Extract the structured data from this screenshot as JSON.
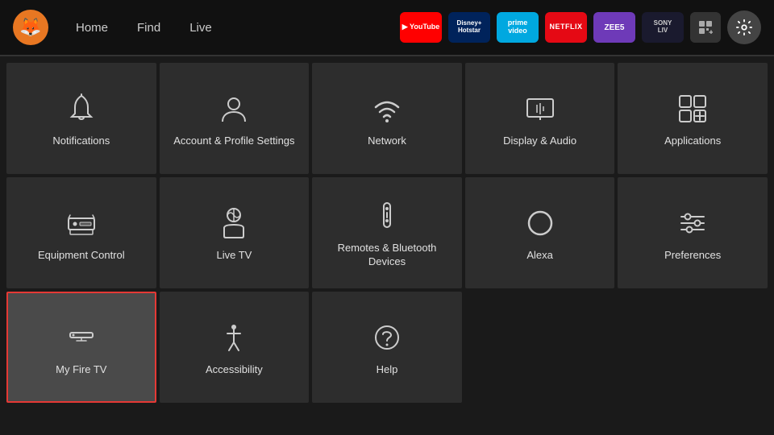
{
  "nav": {
    "logo_emoji": "🦊",
    "links": [
      "Home",
      "Find",
      "Live"
    ],
    "apps": [
      {
        "id": "youtube",
        "label": "▶ YouTube",
        "class": "app-youtube"
      },
      {
        "id": "disney",
        "label": "Disney+ Hotstar",
        "class": "app-disney"
      },
      {
        "id": "prime",
        "label": "prime video",
        "class": "app-prime"
      },
      {
        "id": "netflix",
        "label": "NETFLIX",
        "class": "app-netflix"
      },
      {
        "id": "zee5",
        "label": "ZEE5",
        "class": "app-zee5"
      },
      {
        "id": "sonyliv",
        "label": "SONY LIV",
        "class": "app-sonyliv"
      }
    ]
  },
  "grid": {
    "items": [
      {
        "id": "notifications",
        "label": "Notifications",
        "selected": false
      },
      {
        "id": "account-profile",
        "label": "Account & Profile Settings",
        "selected": false
      },
      {
        "id": "network",
        "label": "Network",
        "selected": false
      },
      {
        "id": "display-audio",
        "label": "Display & Audio",
        "selected": false
      },
      {
        "id": "applications",
        "label": "Applications",
        "selected": false
      },
      {
        "id": "equipment-control",
        "label": "Equipment Control",
        "selected": false
      },
      {
        "id": "live-tv",
        "label": "Live TV",
        "selected": false
      },
      {
        "id": "remotes-bluetooth",
        "label": "Remotes & Bluetooth Devices",
        "selected": false
      },
      {
        "id": "alexa",
        "label": "Alexa",
        "selected": false
      },
      {
        "id": "preferences",
        "label": "Preferences",
        "selected": false
      },
      {
        "id": "my-fire-tv",
        "label": "My Fire TV",
        "selected": true
      },
      {
        "id": "accessibility",
        "label": "Accessibility",
        "selected": false
      },
      {
        "id": "help",
        "label": "Help",
        "selected": false
      }
    ]
  }
}
